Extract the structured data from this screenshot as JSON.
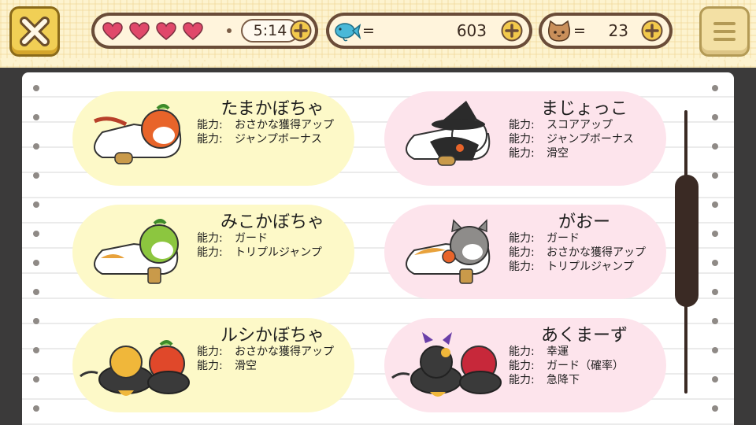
{
  "hud": {
    "hearts_count": 4,
    "timer": "5:14",
    "fish_eq": "=",
    "fish_value": "603",
    "cat_eq": "=",
    "cat_value": "23"
  },
  "icons": {
    "close": "close-icon",
    "menu": "menu-icon",
    "heart": "heart-icon",
    "fish": "fish-icon",
    "cat_face": "cat-face-icon",
    "plus": "plus-icon"
  },
  "colors": {
    "heart": "#e0486a",
    "plus": "#f2c94c",
    "fish": "#49b8d8",
    "card_yellow": "#fdf9c8",
    "card_pink": "#fde4ec"
  },
  "ability_label": "能力:",
  "characters": [
    {
      "name": "たまかぼちゃ",
      "abilities": [
        "おさかな獲得アップ",
        "ジャンプボーナス"
      ]
    },
    {
      "name": "まじょっこ",
      "abilities": [
        "スコアアップ",
        "ジャンプボーナス",
        "滑空"
      ]
    },
    {
      "name": "みこかぼちゃ",
      "abilities": [
        "ガード",
        "トリプルジャンプ"
      ]
    },
    {
      "name": "がおー",
      "abilities": [
        "ガード",
        "おさかな獲得アップ",
        "トリプルジャンプ"
      ]
    },
    {
      "name": "ルシかぼちゃ",
      "abilities": [
        "おさかな獲得アップ",
        "滑空"
      ]
    },
    {
      "name": "あくまーず",
      "abilities": [
        "幸運",
        "ガード（確率）",
        "急降下"
      ]
    }
  ]
}
